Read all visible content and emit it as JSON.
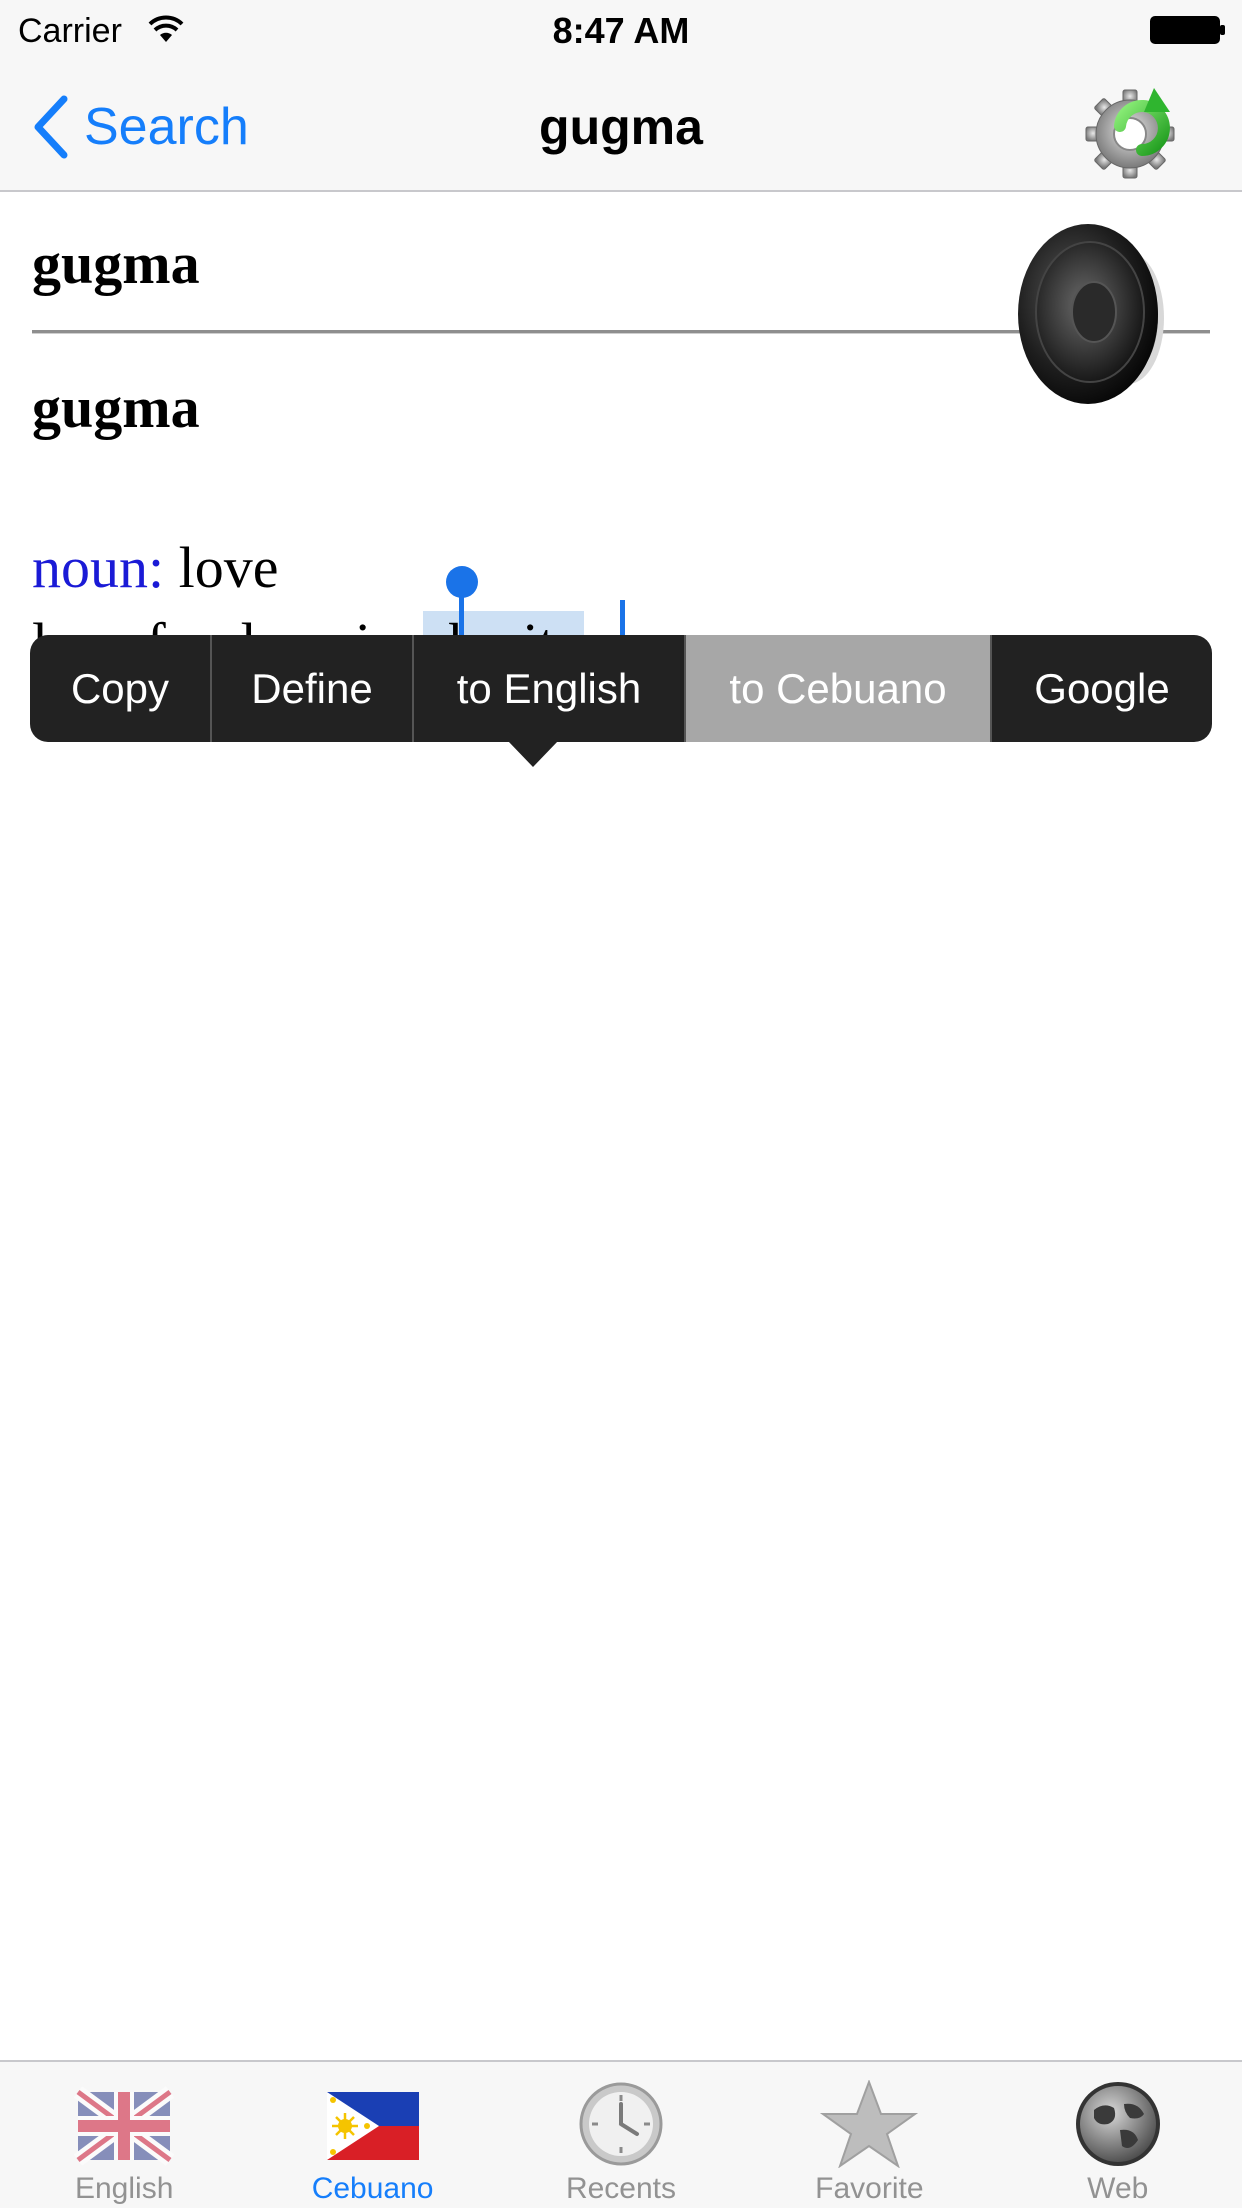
{
  "status_bar": {
    "carrier": "Carrier",
    "time": "8:47 AM"
  },
  "nav": {
    "back_label": "Search",
    "title": "gugma"
  },
  "entry": {
    "headword": "gugma",
    "word": "gugma",
    "definition": {
      "pos": "noun:",
      "pos_gloss": " love",
      "line2_prefix": "love for, love is, ",
      "selected_text": "charity"
    }
  },
  "edit_menu": {
    "items": [
      {
        "label": "Copy"
      },
      {
        "label": "Define"
      },
      {
        "label": "to English"
      },
      {
        "label": "to Cebuano",
        "highlighted": true
      },
      {
        "label": "Google"
      }
    ]
  },
  "tab_bar": {
    "tabs": [
      {
        "label": "English",
        "icon": "uk-flag-icon"
      },
      {
        "label": "Cebuano",
        "icon": "philippines-flag-icon",
        "active": true
      },
      {
        "label": "Recents",
        "icon": "clock-icon"
      },
      {
        "label": "Favorite",
        "icon": "star-icon"
      },
      {
        "label": "Web",
        "icon": "globe-icon"
      }
    ]
  },
  "colors": {
    "accent": "#157efb",
    "pos": "#1a1ad6",
    "selection": "#cde0f4",
    "menu_bg": "#222222",
    "menu_highlight": "#a7a7a7"
  }
}
